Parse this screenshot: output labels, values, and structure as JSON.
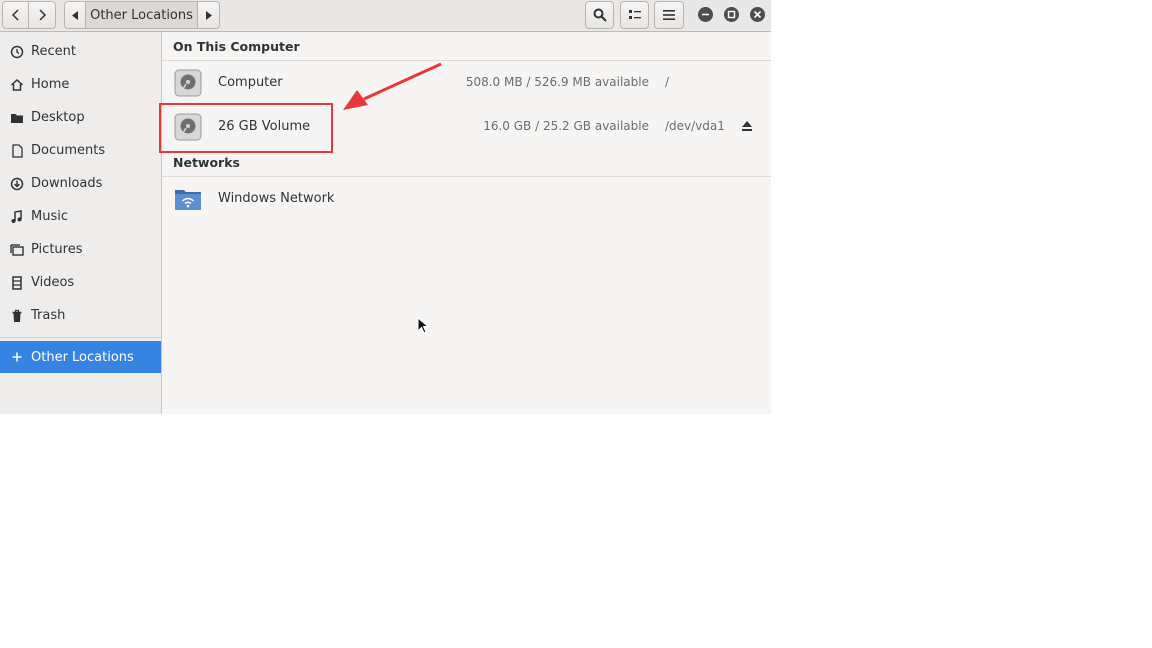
{
  "header": {
    "breadcrumb": "Other Locations"
  },
  "sidebar": {
    "items": [
      {
        "label": "Recent",
        "icon": "clock-icon"
      },
      {
        "label": "Home",
        "icon": "home-icon"
      },
      {
        "label": "Desktop",
        "icon": "folder-icon"
      },
      {
        "label": "Documents",
        "icon": "document-icon"
      },
      {
        "label": "Downloads",
        "icon": "download-icon"
      },
      {
        "label": "Music",
        "icon": "music-icon"
      },
      {
        "label": "Pictures",
        "icon": "pictures-icon"
      },
      {
        "label": "Videos",
        "icon": "video-icon"
      },
      {
        "label": "Trash",
        "icon": "trash-icon"
      }
    ],
    "other_locations": {
      "label": "Other Locations",
      "icon": "plus-icon"
    }
  },
  "main": {
    "section_computer": "On This Computer",
    "computer": {
      "name": "Computer",
      "available": "508.0 MB / 526.9 MB available",
      "mount": "/"
    },
    "volume": {
      "name": "26 GB Volume",
      "available": "16.0 GB / 25.2 GB available",
      "mount": "/dev/vda1"
    },
    "section_networks": "Networks",
    "network": {
      "name": "Windows Network"
    }
  },
  "colors": {
    "accent": "#3584e4",
    "annotation": "#e8383a"
  }
}
